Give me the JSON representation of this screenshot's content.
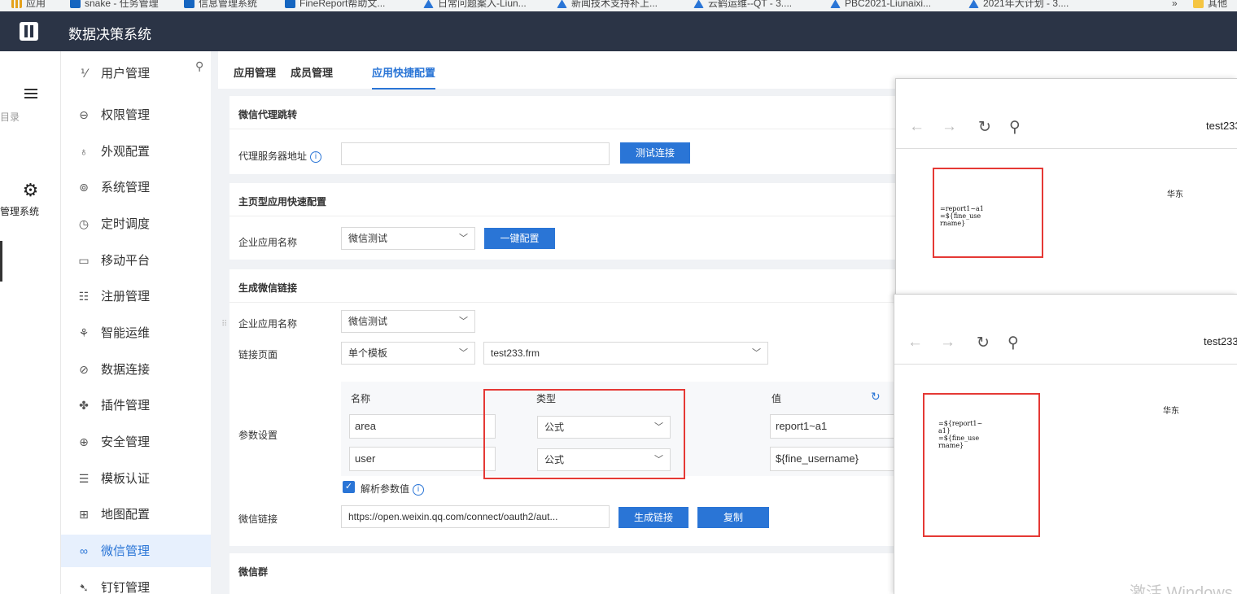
{
  "bookmarks": [
    {
      "label": "应用",
      "icon": "apps-icon"
    },
    {
      "label": "snake - 任务管理",
      "icon": "finereport-icon"
    },
    {
      "label": "信息管理系统",
      "icon": "finereport-icon"
    },
    {
      "label": "FineReport帮助文...",
      "icon": "finereport-icon"
    },
    {
      "label": "日常问题案入-Liun...",
      "icon": "bird-icon"
    },
    {
      "label": "新闻技术支持补上...",
      "icon": "bird-icon"
    },
    {
      "label": "云鹤运维--QT - 3....",
      "icon": "bird-icon"
    },
    {
      "label": "PBC2021-Liunaixi...",
      "icon": "bird-icon"
    },
    {
      "label": "2021年大计划 - 3....",
      "icon": "bird-icon"
    },
    {
      "label": "»",
      "icon": ""
    },
    {
      "label": "其他",
      "icon": "folder-icon"
    }
  ],
  "app": {
    "title": "数据决策系统"
  },
  "leftnav": [
    {
      "label": "目录",
      "icon": "menu-icon"
    },
    {
      "label": "管理系统",
      "icon": "gear-icon"
    }
  ],
  "subnav": [
    {
      "label": "用户管理",
      "icon": "user-icon"
    },
    {
      "label": "权限管理",
      "icon": "lock-icon"
    },
    {
      "label": "外观配置",
      "icon": "palette-icon"
    },
    {
      "label": "系统管理",
      "icon": "settings-icon"
    },
    {
      "label": "定时调度",
      "icon": "timer-icon"
    },
    {
      "label": "移动平台",
      "icon": "mobile-icon"
    },
    {
      "label": "注册管理",
      "icon": "register-icon"
    },
    {
      "label": "智能运维",
      "icon": "ops-icon"
    },
    {
      "label": "数据连接",
      "icon": "link-icon"
    },
    {
      "label": "插件管理",
      "icon": "plugin-icon"
    },
    {
      "label": "安全管理",
      "icon": "shield-icon"
    },
    {
      "label": "模板认证",
      "icon": "template-icon"
    },
    {
      "label": "地图配置",
      "icon": "map-icon"
    },
    {
      "label": "微信管理",
      "icon": "wechat-icon"
    },
    {
      "label": "钉钉管理",
      "icon": "dingtalk-icon"
    }
  ],
  "tabs": [
    {
      "label": "应用管理"
    },
    {
      "label": "成员管理"
    },
    {
      "label": "应用快捷配置"
    }
  ],
  "proxy": {
    "title": "微信代理跳转",
    "label": "代理服务器地址",
    "value": "",
    "test_button": "测试连接"
  },
  "homepage": {
    "title": "主页型应用快速配置",
    "label": "企业应用名称",
    "app_name": "微信测试",
    "config_button": "一键配置"
  },
  "link": {
    "title": "生成微信链接",
    "app_label": "企业应用名称",
    "app_name": "微信测试",
    "page_label": "链接页面",
    "page_type": "单个模板",
    "page_file": "test233.frm",
    "params_label": "参数设置",
    "headers": {
      "name": "名称",
      "type": "类型",
      "value": "值"
    },
    "params": [
      {
        "name": "area",
        "type": "公式",
        "value": "report1~a1"
      },
      {
        "name": "user",
        "type": "公式",
        "value": "${fine_username}"
      }
    ],
    "parse_label": "解析参数值",
    "parse_checked": true,
    "wx_label": "微信链接",
    "wx_url": "https://open.weixin.qq.com/connect/oauth2/aut...",
    "generate_button": "生成链接",
    "copy_button": "复制"
  },
  "group": {
    "title": "微信群"
  },
  "preview": [
    {
      "title": "test233",
      "formula": "=report1~a1\n=${fine_use\nrname}",
      "region": "华东"
    },
    {
      "title": "test233",
      "formula": "=${report1~\na1}\n=${fine_use\nrname}",
      "region": "华东"
    }
  ],
  "watermark": "激活 Windows"
}
